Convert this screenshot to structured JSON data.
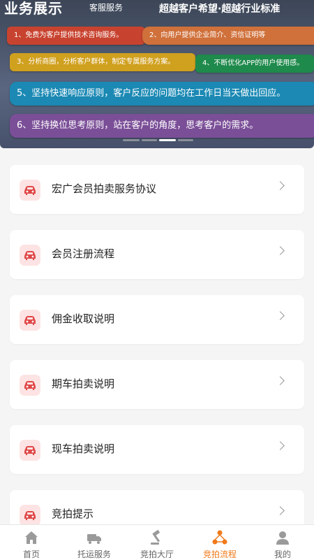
{
  "banner": {
    "title": "业务展示",
    "subtitle": "客服服务",
    "slogan": "超越客户希望·超越行业标准",
    "items": [
      "1、免费为客户提供技术咨询服务。",
      "2、向用户提供企业简介、资信证明等",
      "3、分析商圈，分析客户群体，制定专属服务方案。",
      "4、不断优化APP的用户使用感。",
      "5、坚持快速响应原则，客户反应的问题均在工作日当天做出回应。",
      "6、坚持换位思考原则，站在客户的角度，思考客户的需求。"
    ],
    "indicator_count": 4,
    "indicator_active": 2
  },
  "list": {
    "items": [
      {
        "label": "宏广会员拍卖服务协议"
      },
      {
        "label": "会员注册流程"
      },
      {
        "label": "佣金收取说明"
      },
      {
        "label": "期车拍卖说明"
      },
      {
        "label": "现车拍卖说明"
      },
      {
        "label": "竞拍提示"
      }
    ]
  },
  "tabbar": {
    "tabs": [
      {
        "label": "首页",
        "icon": "home-icon"
      },
      {
        "label": "托运服务",
        "icon": "truck-icon"
      },
      {
        "label": "竞拍大厅",
        "icon": "gavel-icon"
      },
      {
        "label": "竞拍流程",
        "icon": "flow-icon",
        "active": true
      },
      {
        "label": "我的",
        "icon": "user-icon"
      }
    ]
  },
  "colors": {
    "accent": "#f07a1a",
    "icon_red": "#e04848",
    "icon_bg": "#fde3e3"
  }
}
